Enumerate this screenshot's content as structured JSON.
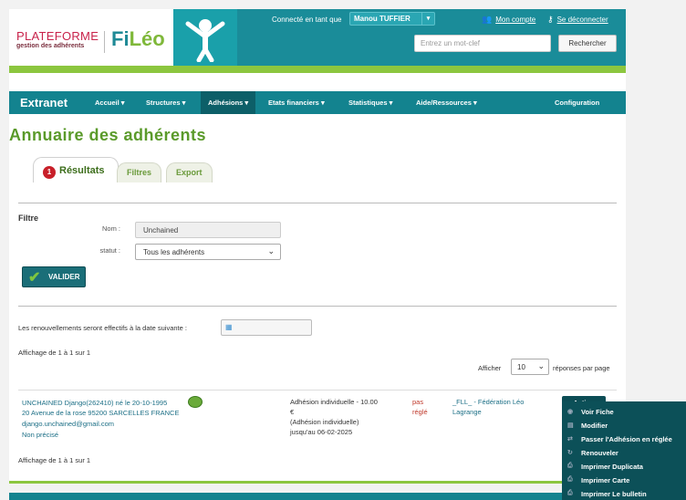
{
  "header": {
    "brand_plat": "PLATEFORME",
    "brand_sub": "gestion des adhérents",
    "brand_fi": "Fi",
    "brand_leo": "Léo",
    "connected_label": "Connecté en tant que",
    "user_name": "Manou TUFFIER",
    "account_link": "Mon compte",
    "logout_link": "Se déconnecter",
    "search_placeholder": "Entrez un mot-clef",
    "search_button": "Rechercher"
  },
  "nav": {
    "brand": "Extranet",
    "items": [
      {
        "label": "Accueil ▾"
      },
      {
        "label": "Structures ▾"
      },
      {
        "label": "Adhésions ▾"
      },
      {
        "label": "Etats financiers ▾"
      },
      {
        "label": "Statistiques ▾"
      },
      {
        "label": "Aide/Ressources ▾"
      },
      {
        "label": "Configuration"
      }
    ]
  },
  "page_title": "Annuaire des adhérents",
  "tabs": {
    "badge": "1",
    "items": [
      {
        "label": "Résultats"
      },
      {
        "label": "Filtres"
      },
      {
        "label": "Export"
      }
    ]
  },
  "filter": {
    "title": "Filtre",
    "nom_label": "Nom :",
    "nom_value": "Unchained",
    "statut_label": "statut :",
    "statut_value": "Tous les adhérents",
    "valider": "VALIDER"
  },
  "renewal_text": "Les renouvellements seront effectifs à la date suivante :",
  "pagination": {
    "top": "Affichage de 1 à 1 sur 1",
    "bottom": "Affichage de 1 à 1 sur 1",
    "afficher": "Afficher",
    "per_page": "10",
    "reponses": "réponses par page"
  },
  "result": {
    "name": "UNCHAINED Django(262410) né le 20-10-1995",
    "address": "20 Avenue de la rose 95200 SARCELLES FRANCE",
    "email": "django.unchained@gmail.com",
    "extra": "Non précisé",
    "adhesion_line1": "Adhésion individuelle - 10.00",
    "adhesion_line2": "€",
    "adhesion_line3": "(Adhésion individuelle)",
    "adhesion_line4": "jusqu'au 06-02-2025",
    "payment_line1": "pas",
    "payment_line2": "réglé",
    "federation_line1": "_FLL_ - Fédération Léo",
    "federation_line2": "Lagrange",
    "action": "Action",
    "status_color": "#6aaa3a"
  },
  "action_menu": [
    {
      "label": "Voir Fiche",
      "icon": "eye-icon"
    },
    {
      "label": "Modifier",
      "icon": "edit-icon"
    },
    {
      "label": "Passer l'Adhésion en réglée",
      "icon": "swap-icon"
    },
    {
      "label": "Renouveler",
      "icon": "renew-icon"
    },
    {
      "label": "Imprimer Duplicata",
      "icon": "print-icon"
    },
    {
      "label": "Imprimer Carte",
      "icon": "print-icon"
    },
    {
      "label": "Imprimer Le bulletin",
      "icon": "print-icon"
    }
  ],
  "colors": {
    "teal": "#13838f",
    "green": "#8cc63f",
    "title_green": "#5a9a2a",
    "menu_bg": "#0c5058"
  }
}
